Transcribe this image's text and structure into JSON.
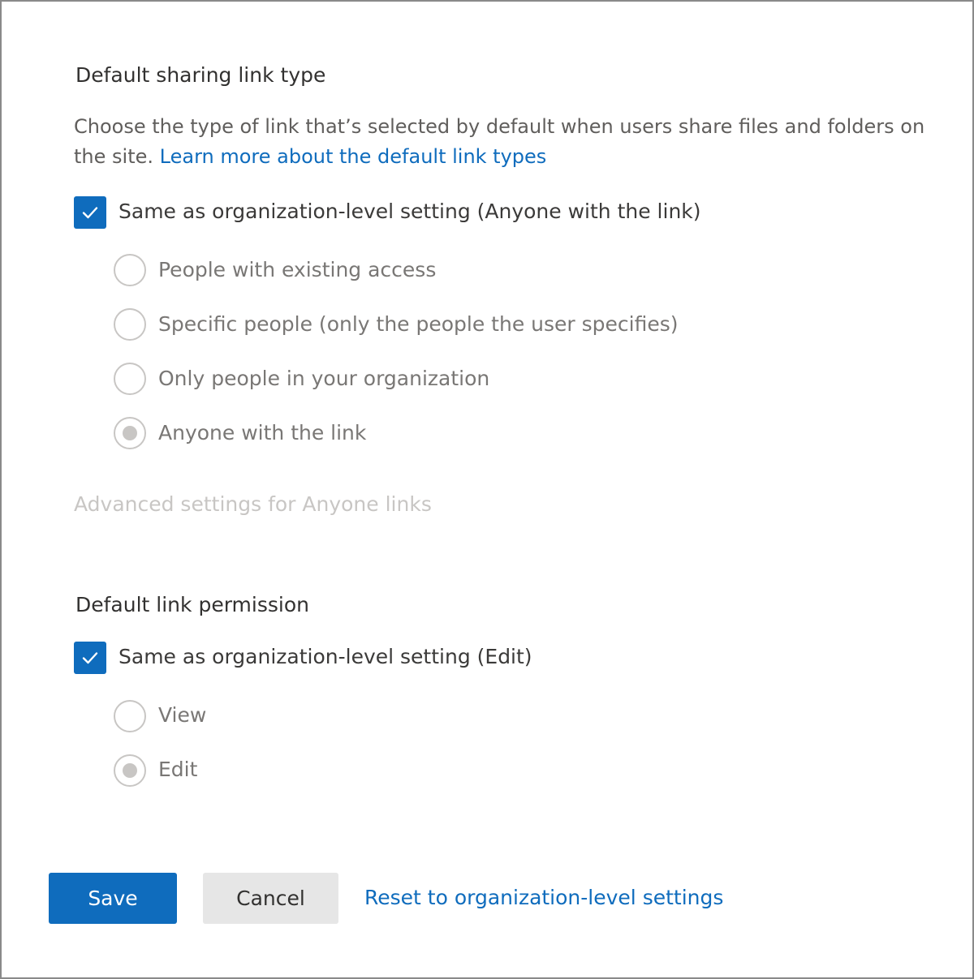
{
  "sharing": {
    "title": "Default sharing link type",
    "description": "Choose the type of link that’s selected by default when users share files and folders on the site.",
    "learn_more": "Learn more about the default link types",
    "same_as_org": {
      "label": "Same as organization-level setting (Anyone with the link)",
      "checked": true
    },
    "options": [
      {
        "label": "People with existing access",
        "selected": false
      },
      {
        "label": "Specific people (only the people the user specifies)",
        "selected": false
      },
      {
        "label": "Only people in your organization",
        "selected": false
      },
      {
        "label": "Anyone with the link",
        "selected": true
      }
    ],
    "advanced": "Advanced settings for Anyone links"
  },
  "permission": {
    "title": "Default link permission",
    "same_as_org": {
      "label": "Same as organization-level setting (Edit)",
      "checked": true
    },
    "options": [
      {
        "label": "View",
        "selected": false
      },
      {
        "label": "Edit",
        "selected": true
      }
    ]
  },
  "actions": {
    "save": "Save",
    "cancel": "Cancel",
    "reset": "Reset to organization-level settings"
  },
  "colors": {
    "accent": "#0f6cbd",
    "disabled": "#c8c6c4",
    "button_secondary": "#e6e6e6"
  },
  "icons": {
    "checkbox": "checkmark-icon",
    "radio": "radio-button-icon"
  }
}
